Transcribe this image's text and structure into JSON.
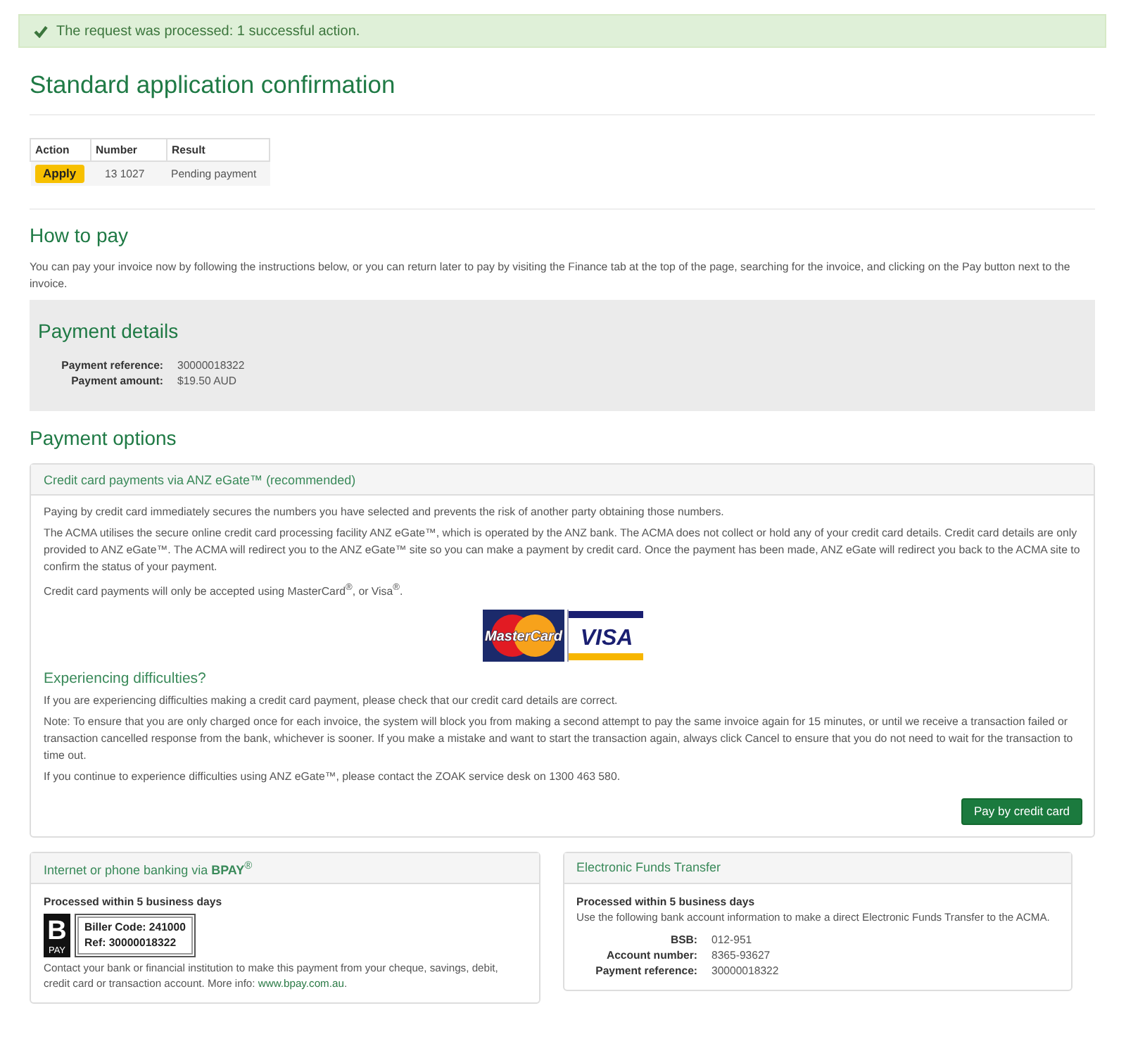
{
  "alert": {
    "text": "The request was processed: 1 successful action."
  },
  "title": "Standard application confirmation",
  "results_table": {
    "columns": [
      "Action",
      "Number",
      "Result"
    ],
    "rows": [
      {
        "action": "Apply",
        "number": "13 1027",
        "result": "Pending payment"
      }
    ]
  },
  "how_to_pay": {
    "heading": "How to pay",
    "text": "You can pay your invoice now by following the instructions below, or you can return later to pay by visiting the Finance tab at the top of the page, searching for the invoice, and clicking on the Pay button next to the invoice."
  },
  "payment_details": {
    "heading": "Payment details",
    "fields": [
      {
        "label": "Payment reference:",
        "value": "30000018322"
      },
      {
        "label": "Payment amount:",
        "value": "$19.50 AUD"
      }
    ]
  },
  "payment_options": {
    "heading": "Payment options",
    "credit_card": {
      "title": "Credit card payments via ANZ eGate™ (recommended)",
      "paragraphs": [
        "Paying by credit card immediately secures the numbers you have selected and prevents the risk of another party obtaining those numbers.",
        "The ACMA utilises the secure online credit card processing facility ANZ eGate™, which is operated by the ANZ bank. The ACMA does not collect or hold any of your credit card details. Credit card details are only provided to ANZ eGate™. The ACMA will redirect you to the ANZ eGate™ site so you can make a payment by credit card. Once the payment has been made, ANZ eGate will redirect you back to the ACMA site to confirm the status of your payment.",
        "Credit card payments will only be accepted using MasterCard$^{®}$, or Visa$^{®}$."
      ],
      "logos": [
        {
          "kind": "mastercard",
          "text": "MasterCard"
        },
        {
          "kind": "visa",
          "text": "VISA"
        }
      ],
      "difficulties": {
        "heading": "Experiencing difficulties?",
        "paragraphs": [
          "If you are experiencing difficulties making a credit card payment, please check that our credit card details are correct.",
          "Note: To ensure that you are only charged once for each invoice, the system will block you from making a second attempt to pay the same invoice again for 15 minutes, or until we receive a transaction failed or transaction cancelled response from the bank, whichever is sooner. If you make a mistake and want to start the transaction again, always click Cancel to ensure that you do not need to wait for the transaction to time out.",
          "If you continue to experience difficulties using ANZ eGate™, please contact the ZOAK service desk on 1300 463 580."
        ]
      },
      "button": "Pay by credit card"
    },
    "bpay": {
      "title": "Internet or phone banking via **BPAY**$^{®}$",
      "subheading": "Processed within 5 business days",
      "logo": {
        "mark": "B",
        "caption": "PAY"
      },
      "biller_lines": [
        "Biller Code: 241000",
        "Ref: 30000018322"
      ],
      "info": {
        "text": "Contact your bank or financial institution to make this payment from your cheque, savings, debit, credit card or transaction account. More info:",
        "link": "www.bpay.com.au",
        "after": "."
      }
    },
    "eft": {
      "title": "Electronic Funds Transfer",
      "subheading": "Processed within 5 business days",
      "text": "Use the following bank account information to make a direct Electronic Funds Transfer to the ACMA.",
      "fields": [
        {
          "label": "BSB:",
          "value": "012-951"
        },
        {
          "label": "Account number:",
          "value": "8365-93627"
        },
        {
          "label": "Payment reference:",
          "value": "30000018322"
        }
      ]
    }
  }
}
